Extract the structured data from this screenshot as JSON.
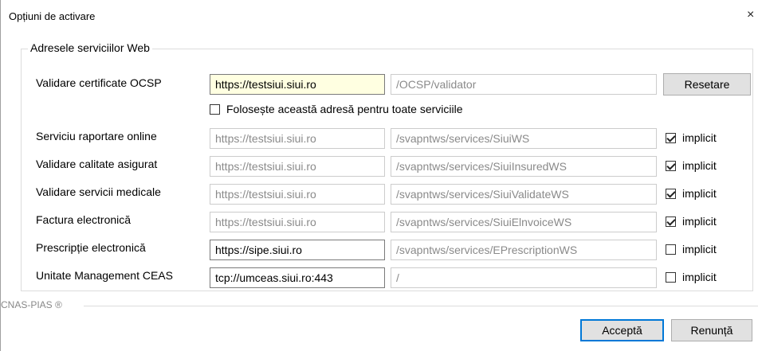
{
  "window": {
    "title": "Opțiuni de activare",
    "close_glyph": "×"
  },
  "group": {
    "legend": "Adresele serviciilor Web"
  },
  "ocsp": {
    "label": "Validare certificate OCSP",
    "host": "https://testsiui.siui.ro",
    "path": "/OCSP/validator",
    "reset_label": "Resetare",
    "use_for_all_label": "Folosește această adresă pentru toate serviciile",
    "use_for_all_checked": false
  },
  "services": [
    {
      "label": "Serviciu raportare online",
      "host": "https://testsiui.siui.ro",
      "path": "/svapntws/services/SiuiWS",
      "implicit_label": "implicit",
      "implicit_checked": true,
      "host_enabled": false
    },
    {
      "label": "Validare calitate asigurat",
      "host": "https://testsiui.siui.ro",
      "path": "/svapntws/services/SiuiInsuredWS",
      "implicit_label": "implicit",
      "implicit_checked": true,
      "host_enabled": false
    },
    {
      "label": "Validare servicii medicale",
      "host": "https://testsiui.siui.ro",
      "path": "/svapntws/services/SiuiValidateWS",
      "implicit_label": "implicit",
      "implicit_checked": true,
      "host_enabled": false
    },
    {
      "label": "Factura electronică",
      "host": "https://testsiui.siui.ro",
      "path": "/svapntws/services/SiuiElnvoiceWS",
      "implicit_label": "implicit",
      "implicit_checked": true,
      "host_enabled": false
    },
    {
      "label": "Prescripție electronică",
      "host": "https://sipe.siui.ro",
      "path": "/svapntws/services/EPrescriptionWS",
      "implicit_label": "implicit",
      "implicit_checked": false,
      "host_enabled": true
    },
    {
      "label": "Unitate Management CEAS",
      "host": "tcp://umceas.siui.ro:443",
      "path": "/",
      "implicit_label": "implicit",
      "implicit_checked": false,
      "host_enabled": true
    }
  ],
  "footer": {
    "brand": "CNAS-PIAS ®"
  },
  "buttons": {
    "accept": "Acceptă",
    "cancel": "Renunță"
  }
}
